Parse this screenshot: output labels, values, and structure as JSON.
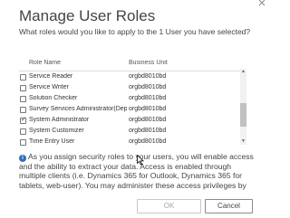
{
  "dialog": {
    "title": "Manage User Roles",
    "subtitle": "What roles would you like to apply to the 1 User you have selected?"
  },
  "table": {
    "headers": {
      "role": "Role Name",
      "business_unit": "Business Unit"
    },
    "rows": [
      {
        "role": "Service Reader",
        "business_unit": "orgbd8010bd",
        "checked": false
      },
      {
        "role": "Service Writer",
        "business_unit": "orgbd8010bd",
        "checked": false
      },
      {
        "role": "Solution Checker",
        "business_unit": "orgbd8010bd",
        "checked": false
      },
      {
        "role": "Survey Services Administrator(Depr...",
        "business_unit": "orgbd8010bd",
        "checked": false
      },
      {
        "role": "System Administrator",
        "business_unit": "orgbd8010bd",
        "checked": true
      },
      {
        "role": "System Customizer",
        "business_unit": "orgbd8010bd",
        "checked": false
      },
      {
        "role": "Time Entry User",
        "business_unit": "orgbd8010bd",
        "checked": false
      }
    ]
  },
  "info": {
    "icon": "info-icon",
    "text": "As you assign security roles to your users, you will enable access and the ability to extract your data. Access is enabled through multiple clients (i.e. Dynamics 365 for Outlook, Dynamics 365 for tablets, web-user). You may administer these access privileges by"
  },
  "buttons": {
    "ok": "OK",
    "cancel": "Cancel"
  },
  "colors": {
    "info_icon": "#2e6fb6",
    "text": "#444444"
  }
}
